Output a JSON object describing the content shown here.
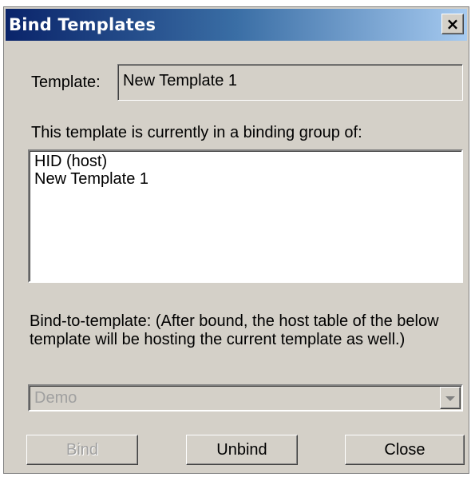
{
  "window": {
    "title": "Bind Templates",
    "close_glyph": "×"
  },
  "template": {
    "label": "Template:",
    "value": "New Template 1"
  },
  "group": {
    "label": "This template is currently in a binding group of:",
    "items": [
      "HID (host)",
      "New Template 1"
    ]
  },
  "bind_to": {
    "description": "Bind-to-template: (After bound, the host table of the below template will be hosting the current template as well.)",
    "selected": "Demo",
    "disabled": true
  },
  "buttons": {
    "bind": "Bind",
    "unbind": "Unbind",
    "close": "Close"
  },
  "colors": {
    "face": "#d4d0c8",
    "title_start": "#0a246a",
    "title_end": "#a6caf0",
    "disabled_text": "#a0a0a0"
  }
}
